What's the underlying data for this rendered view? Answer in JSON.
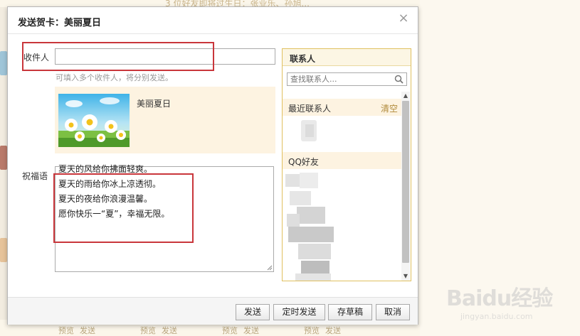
{
  "background": {
    "top_notice": "3 位好友即将过生日：张业乐、孙旭...",
    "bottom_links": [
      "预览",
      "发送",
      "预览",
      "发送",
      "预览",
      "发送",
      "预览",
      "发送"
    ]
  },
  "watermark": {
    "logo": "Baidu经验",
    "url": "jingyan.baidu.com"
  },
  "dialog": {
    "title": "发送贺卡：美丽夏日",
    "close_symbol": "×",
    "recipient": {
      "label": "收件人",
      "value": "",
      "placeholder": "",
      "hint": "可填入多个收件人，将分别发送。"
    },
    "card": {
      "name": "美丽夏日"
    },
    "blessing": {
      "label": "祝福语",
      "lines": [
        "夏天的风给你拂面轻爽。",
        "夏天的雨给你冰上凉透彻。",
        "夏天的夜给你浪漫温馨。",
        "愿你快乐一“夏”，幸福无限。"
      ]
    },
    "contacts": {
      "title": "联系人",
      "search_placeholder": "查找联系人...",
      "groups": [
        {
          "label": "最近联系人",
          "action": "清空"
        },
        {
          "label": "QQ好友",
          "action": ""
        }
      ]
    },
    "buttons": {
      "send": "发送",
      "scheduled_send": "定时发送",
      "save_draft": "存草稿",
      "cancel": "取消"
    }
  },
  "colors": {
    "highlight_box": "#c9363b",
    "panel_border": "#e0c060",
    "card_bg": "#fdf3e1",
    "page_bg": "#fbf6ea"
  }
}
